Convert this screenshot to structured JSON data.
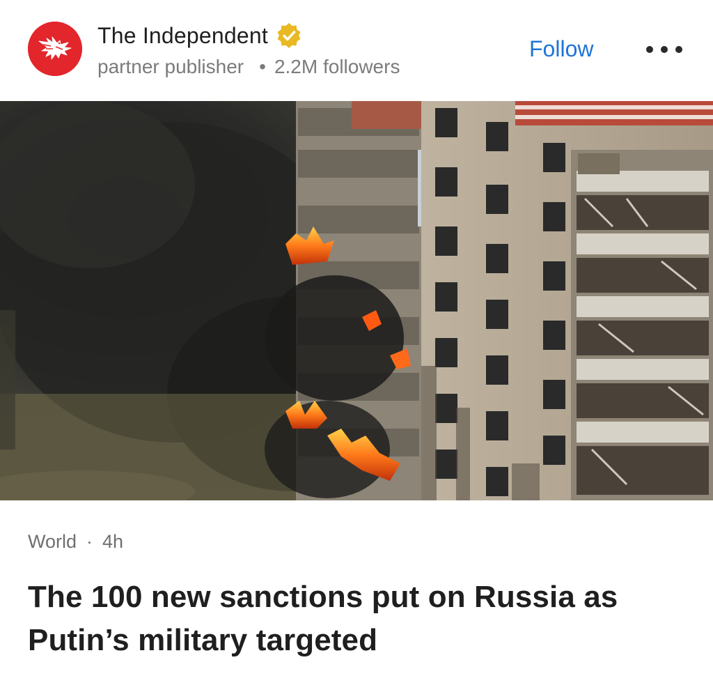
{
  "publisher": {
    "name": "The Independent",
    "type": "partner publisher",
    "followers": "2.2M followers",
    "verified": true,
    "logo_icon": "eagle-icon",
    "brand_color": "#e2262c",
    "verified_color": "#e8b923"
  },
  "actions": {
    "follow_label": "Follow",
    "more_icon": "more-options-icon",
    "accent_color": "#1e74d8"
  },
  "image": {
    "subject": "burning-apartment-building-photo"
  },
  "article": {
    "category": "World",
    "separator": "·",
    "age": "4h",
    "headline": "The 100 new sanctions put on Russia as Putin’s military targeted"
  }
}
